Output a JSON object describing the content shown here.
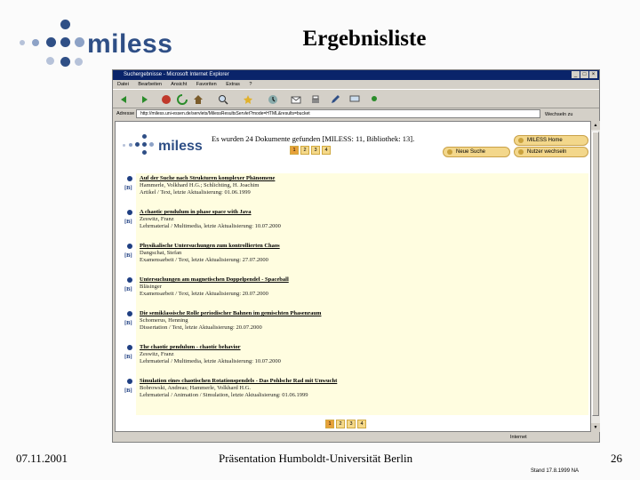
{
  "slide": {
    "logo_text": "miless",
    "title": "Ergebnisliste",
    "footer_date": "07.11.2001",
    "footer_center": "Präsentation Humboldt-Universität Berlin",
    "footer_page": "26",
    "stand": "Stand 17.8.1999   NA"
  },
  "browser": {
    "title": "Suchergebnisse - Microsoft Internet Explorer",
    "menu": [
      "Datei",
      "Bearbeiten",
      "Ansicht",
      "Favoriten",
      "Extras",
      "?"
    ],
    "address_label": "Adresse",
    "address_value": "http://miless.uni-essen.de/servlets/MilessResultsServlet?mode=HTML&results=bucket",
    "go_label": "Wechseln zu",
    "status_zone": "Internet",
    "colors": {
      "titlebar": "#0a246a",
      "chrome": "#d4d0c8"
    }
  },
  "page": {
    "logo_text": "miless",
    "found_text": "Es wurden 24 Dokumente gefunden [MILESS: 11, Bibliothek: 13].",
    "pages": [
      "1",
      "2",
      "3",
      "4"
    ],
    "buttons": {
      "home": "MILESS Home",
      "new_search": "Neue Suche",
      "switch_user": "Nutzer wechseln"
    },
    "results": [
      {
        "tag": "[B]",
        "title": "Auf der Suche nach Strukturen komplexer Phänomene",
        "authors": "Hammerle, Volkhard H.G.; Schlichting, H. Joachim",
        "detail": "Artikel / Text, letzte Aktualisierung: 01.06.1999"
      },
      {
        "tag": "[B]",
        "title": "A chaotic pendulum in phase space with Java",
        "authors": "Zeswitz, Franz",
        "detail": "Lehrmaterial / Multimedia, letzte Aktualisierung: 10.07.2000"
      },
      {
        "tag": "[B]",
        "title": "Physikalische Untersuchungen zum kontrollierten Chaos",
        "authors": "Dangschat, Stefan",
        "detail": "Examensarbeit / Text, letzte Aktualisierung: 27.07.2000"
      },
      {
        "tag": "[B]",
        "title": "Untersuchungen am magnetischen Doppelpendel - Spaceball",
        "authors": "Bläsinger",
        "detail": "Examensarbeit / Text, letzte Aktualisierung: 20.07.2000"
      },
      {
        "tag": "[B]",
        "title": "Die semiklassische Rolle periodischer Bahnen im gemischten Phasenraum",
        "authors": "Schomerus, Henning",
        "detail": "Dissertation / Text, letzte Aktualisierung: 20.07.2000"
      },
      {
        "tag": "[B]",
        "title": "The chaotic pendulum - chaotic behavior",
        "authors": "Zeswitz, Franz",
        "detail": "Lehrmaterial / Multimedia, letzte Aktualisierung: 10.07.2000"
      },
      {
        "tag": "[B]",
        "title": "Simulation eines chaotischen Rotationspendels - Das Pohlsche Rad mit Unwucht",
        "authors": "Bobrowski, Andreas; Hammerle, Volkhard H.G.",
        "detail": "Lehrmaterial / Animation / Simulation, letzte Aktualisierung: 01.06.1999"
      }
    ]
  }
}
